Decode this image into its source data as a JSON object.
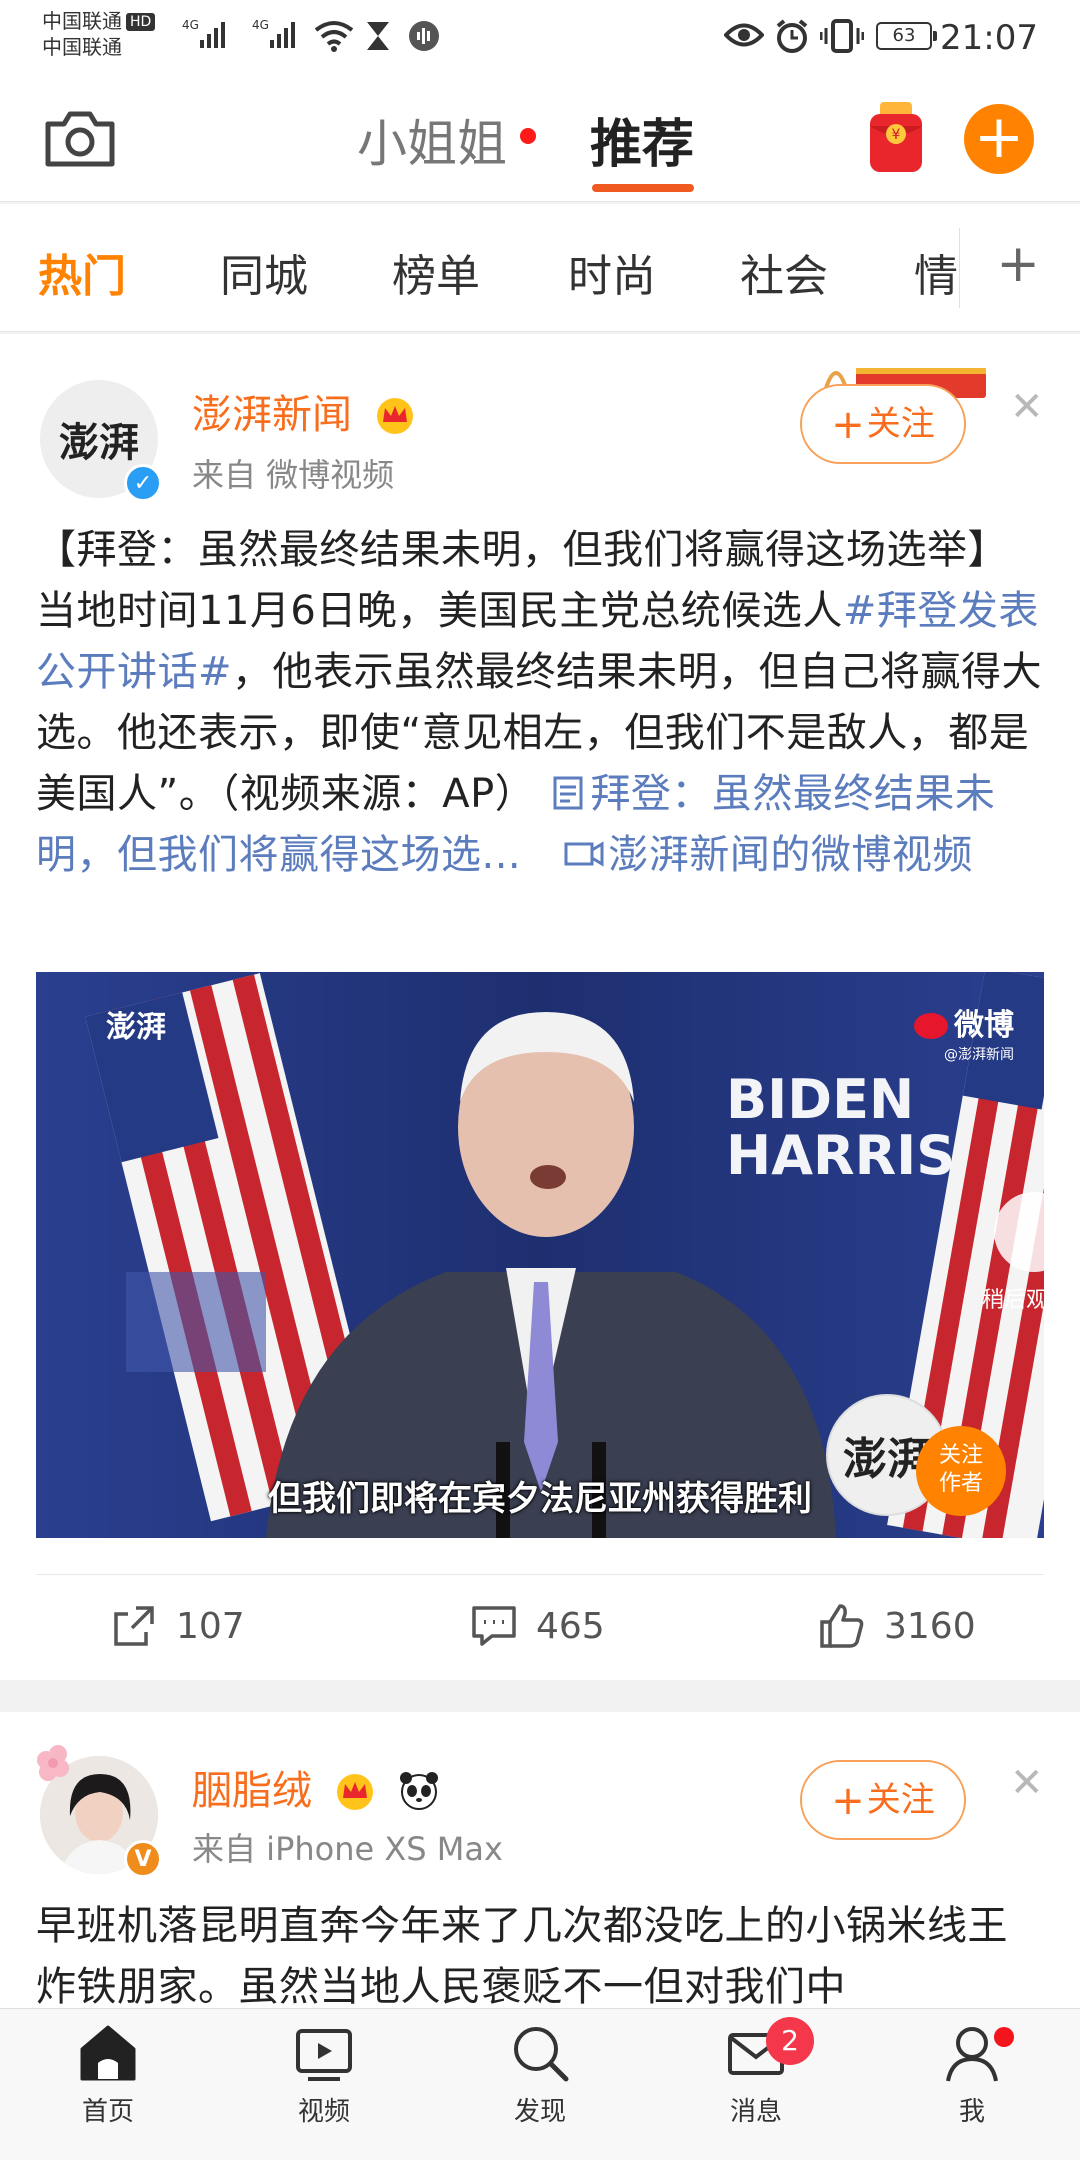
{
  "status_bar": {
    "carrier_1": "中国联通",
    "carrier_2": "中国联通",
    "hd": "HD",
    "network_1": "4G",
    "network_2": "4G",
    "battery": "63",
    "time": "21:07"
  },
  "top_nav": {
    "tab_left": "小姐姐",
    "tab_active": "推荐",
    "accent": "#f05a20"
  },
  "categories": {
    "items": [
      "热门",
      "同城",
      "榜单",
      "时尚",
      "社会",
      "情"
    ],
    "active_index": 0,
    "plus": "+"
  },
  "post1": {
    "author": "澎湃新闻",
    "avatar_text": "澎湃",
    "source": "来自 微博视频",
    "follow_label": "关注",
    "text_before": "【拜登：虽然最终结果未明，但我们将赢得这场选举】当地时间11月6日晚，美国民主党总统候选人",
    "hashtag": "#拜登发表公开讲话#",
    "text_after": "，他表示虽然最终结果未明，但自己将赢得大选。他还表示，即使“意见相左，但我们不是敌人，都是美国人”。（视频来源：AP）",
    "article_link": "拜登：虽然最终结果未明，但我们将赢得这场选...",
    "video_link": "澎湃新闻的微博视频",
    "video": {
      "subtitle": "但我们即将在宾夕法尼亚州获得胜利",
      "watermark": "微博",
      "watermark_sub": "@澎湃新闻",
      "logo": "澎湃",
      "sign_top": "BIDEN",
      "sign_bottom": "HARRIS",
      "follow_author_1": "关注",
      "follow_author_2": "作者",
      "later": "稍后观"
    },
    "reposts": "107",
    "comments": "465",
    "likes": "3160"
  },
  "post2": {
    "author": "胭脂绒",
    "source": "来自 iPhone XS Max",
    "follow_label": "关注",
    "text": "早班机落昆明直奔今年来了几次都没吃上的小锅米线王炸铁朋家。虽然当地人民褒贬不一但对我们中"
  },
  "bottom_bar": {
    "home": "首页",
    "video": "视频",
    "discover": "发现",
    "messages": "消息",
    "messages_badge": "2",
    "me": "我"
  }
}
